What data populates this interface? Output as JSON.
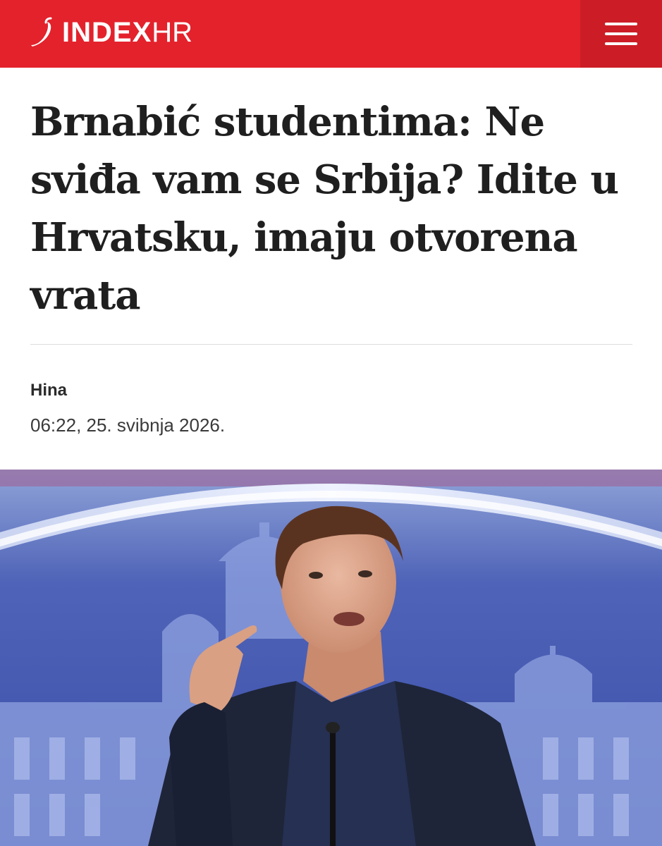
{
  "header": {
    "logo_main": "INDEX",
    "logo_sub": "HR",
    "brand_color": "#e3222c",
    "menu_icon": "hamburger-menu-icon"
  },
  "article": {
    "title": "Brnabić studentima: Ne sviđa vam se Srbija? Idite u Hrvatsku, imaju otvorena vrata",
    "author": "Hina",
    "published": "06:22, 25. svibnja 2026."
  }
}
